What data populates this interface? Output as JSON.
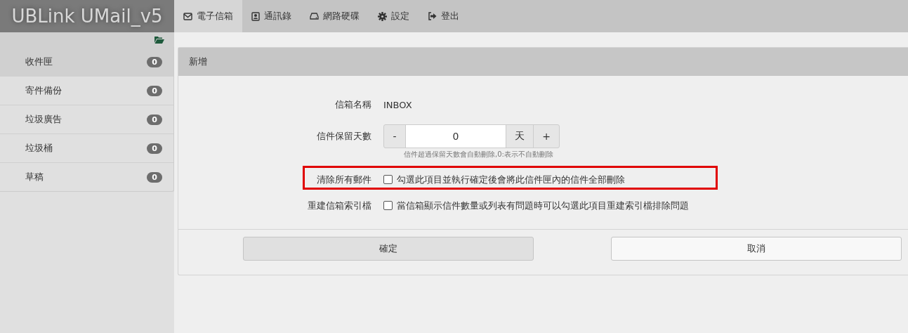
{
  "app": {
    "logo": "UBLink UMail_v5"
  },
  "nav": [
    {
      "label": "電子信箱",
      "kind": "envelope",
      "selected": true
    },
    {
      "label": "通訊錄",
      "kind": "contact",
      "selected": false
    },
    {
      "label": "網路硬碟",
      "kind": "drive",
      "selected": false
    },
    {
      "label": "設定",
      "kind": "gear",
      "selected": false
    },
    {
      "label": "登出",
      "kind": "logout",
      "selected": false
    }
  ],
  "sidebar": {
    "items": [
      {
        "label": "收件匣",
        "count": "0",
        "selected": true
      },
      {
        "label": "寄件備份",
        "count": "0",
        "selected": false
      },
      {
        "label": "垃圾廣告",
        "count": "0",
        "selected": false
      },
      {
        "label": "垃圾桶",
        "count": "0",
        "selected": false
      },
      {
        "label": "草稿",
        "count": "0",
        "selected": false
      }
    ]
  },
  "panel": {
    "title": "新增",
    "fields": [
      {
        "kind": "text",
        "label": "信箱名稱",
        "value": "INBOX"
      },
      {
        "kind": "spinner",
        "label": "信件保留天數",
        "minus": "-",
        "value": "0",
        "unit": "天",
        "plus": "+",
        "hint": "信件超過保留天數會自動刪除,0:表示不自動刪除"
      },
      {
        "kind": "checkbox",
        "label": "清除所有郵件",
        "checked": false,
        "text": "勾選此項目並執行確定後會將此信件匣內的信件全部刪除",
        "highlighted": true
      },
      {
        "kind": "checkbox",
        "label": "重建信箱索引檔",
        "checked": false,
        "text": "當信箱顯示信件數量或列表有問題時可以勾選此項目重建索引檔排除問題",
        "highlighted": false
      }
    ],
    "buttons": [
      {
        "label": "確定",
        "primary": true
      },
      {
        "label": "取消",
        "primary": false
      }
    ]
  }
}
